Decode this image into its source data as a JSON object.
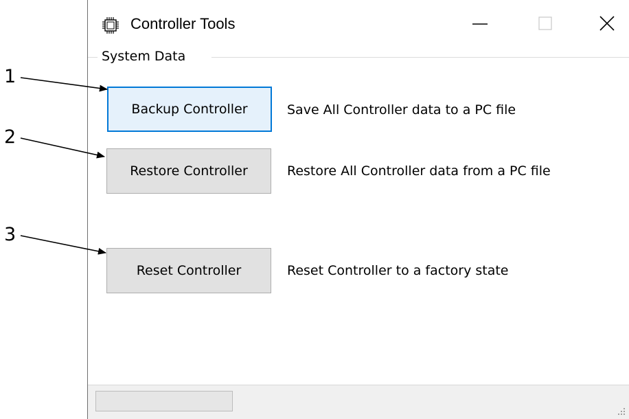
{
  "window": {
    "title": "Controller Tools",
    "app_icon": "chip-icon",
    "controls": {
      "minimize_icon": "minimize-icon",
      "maximize_icon": "maximize-icon",
      "close_icon": "close-icon"
    }
  },
  "group": {
    "label": "System Data"
  },
  "actions": [
    {
      "button_label": "Backup Controller",
      "description": "Save All Controller data to a PC file",
      "focused": true
    },
    {
      "button_label": "Restore Controller",
      "description": "Restore All Controller data from a PC file",
      "focused": false
    },
    {
      "button_label": "Reset Controller",
      "description": "Reset Controller to a factory state",
      "focused": false
    }
  ],
  "callouts": [
    "1",
    "2",
    "3"
  ],
  "statusbar": {
    "panel_text": "",
    "grip_icon": "resize-grip-icon"
  },
  "colors": {
    "focus_border": "#0078d7",
    "button_face": "#e1e1e1",
    "statusbar_bg": "#f0f0f0"
  }
}
